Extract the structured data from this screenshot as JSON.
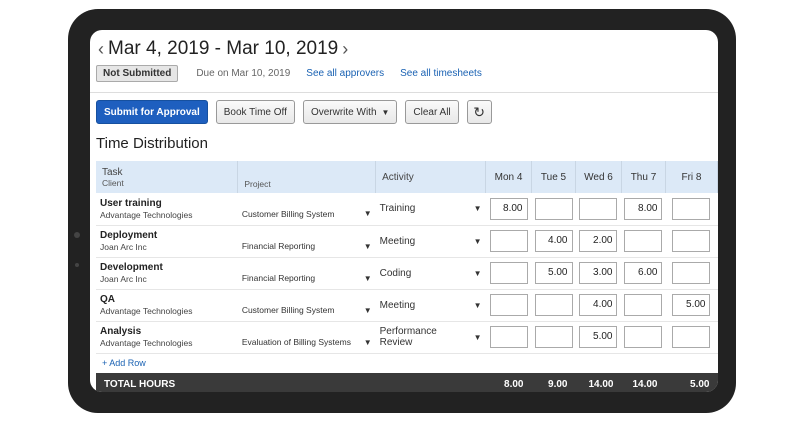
{
  "header": {
    "date_range": "Mar 4, 2019 - Mar 10, 2019",
    "prev_icon": "chevron-left-icon",
    "next_icon": "chevron-right-icon",
    "status": "Not Submitted",
    "due": "Due on Mar 10, 2019",
    "approvers_link": "See all approvers",
    "timesheets_link": "See all timesheets"
  },
  "toolbar": {
    "submit": "Submit for Approval",
    "book_time_off": "Book Time Off",
    "overwrite_with": "Overwrite With",
    "clear_all": "Clear All",
    "refresh_icon": "refresh-icon"
  },
  "section_title": "Time Distribution",
  "table": {
    "columns": {
      "task": "Task",
      "client": "Client",
      "project": "Project",
      "activity": "Activity",
      "days": [
        "Mon 4",
        "Tue 5",
        "Wed 6",
        "Thu 7",
        "Fri 8"
      ]
    },
    "rows": [
      {
        "task": "User training",
        "client": "Advantage Technologies",
        "project": "Customer Billing System",
        "activity": "Training",
        "hours": [
          "8.00",
          "",
          "",
          "8.00",
          ""
        ]
      },
      {
        "task": "Deployment",
        "client": "Joan Arc Inc",
        "project": "Financial Reporting",
        "activity": "Meeting",
        "hours": [
          "",
          "4.00",
          "2.00",
          "",
          ""
        ]
      },
      {
        "task": "Development",
        "client": "Joan Arc Inc",
        "project": "Financial Reporting",
        "activity": "Coding",
        "hours": [
          "",
          "5.00",
          "3.00",
          "6.00",
          ""
        ]
      },
      {
        "task": "QA",
        "client": "Advantage Technologies",
        "project": "Customer Billing System",
        "activity": "Meeting",
        "hours": [
          "",
          "",
          "4.00",
          "",
          "5.00"
        ]
      },
      {
        "task": "Analysis",
        "client": "Advantage Technologies",
        "project": "Evaluation of Billing Systems",
        "activity": "Performance Review",
        "hours": [
          "",
          "",
          "5.00",
          "",
          ""
        ]
      }
    ],
    "add_row": "+ Add Row",
    "total_label": "TOTAL HOURS",
    "totals": [
      "8.00",
      "9.00",
      "14.00",
      "14.00",
      "5.00"
    ]
  },
  "colors": {
    "primary_button": "#1e5fbf",
    "link": "#1a62b3",
    "header_bg": "#dce9f7",
    "total_bg": "#3a3a3a"
  }
}
